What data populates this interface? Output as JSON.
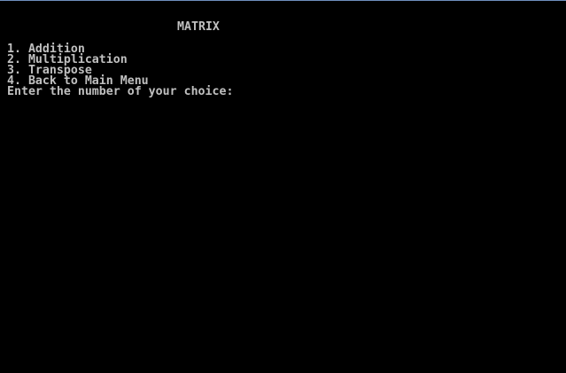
{
  "console": {
    "title": "MATRIX",
    "menu": [
      "1. Addition",
      "2. Multiplication",
      "3. Transpose",
      "4. Back to Main Menu"
    ],
    "prompt": "Enter the number of your choice:"
  }
}
